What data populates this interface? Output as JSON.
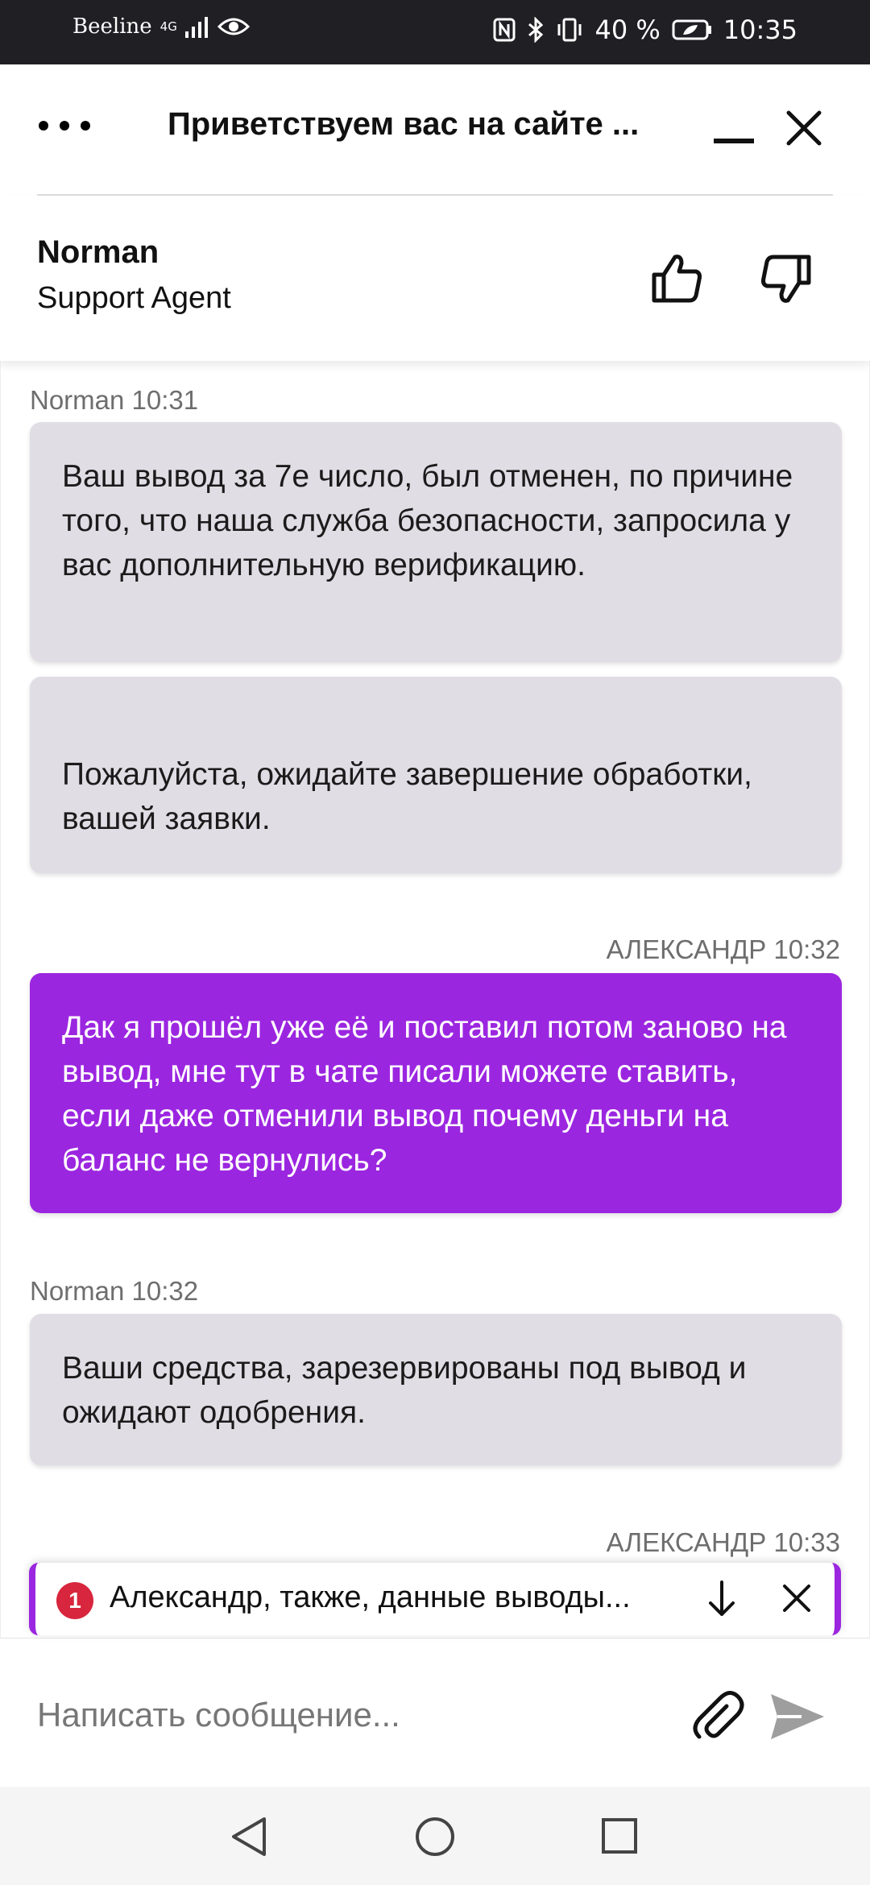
{
  "status_bar": {
    "carrier": "Beeline",
    "network": "4G",
    "battery": "40 %",
    "time": "10:35"
  },
  "header": {
    "title": "Приветствуем вас на сайте ..."
  },
  "agent": {
    "name": "Norman",
    "role": "Support Agent"
  },
  "messages": [
    {
      "meta": "Norman 10:31",
      "text": "Ваш вывод за 7е число, был отменен, по причине того, что наша служба безопасности, запросила у вас дополнительную верификацию."
    },
    {
      "text": "Пожалуйста, ожидайте завершение обработки, вашей заявки."
    },
    {
      "meta": "АЛЕКСАНДР 10:32",
      "text": "Дак я прошёл уже её и поставил потом заново на вывод, мне тут в чате писали можете ставить, если даже отменили вывод почему деньги на баланс не вернулись?"
    },
    {
      "meta": "Norman 10:32",
      "text": "Ваши средства, зарезервированы под вывод и ожидают одобрения."
    },
    {
      "meta": "АЛЕКСАНДР 10:33"
    }
  ],
  "notification": {
    "count": "1",
    "text": "Александр, также, данные выводы..."
  },
  "composer": {
    "placeholder": "Написать сообщение..."
  },
  "colors": {
    "accent": "#9b26e0",
    "agent_bubble": "#e1dde5",
    "badge": "#d7263d",
    "status_bar": "#1f1f24"
  }
}
